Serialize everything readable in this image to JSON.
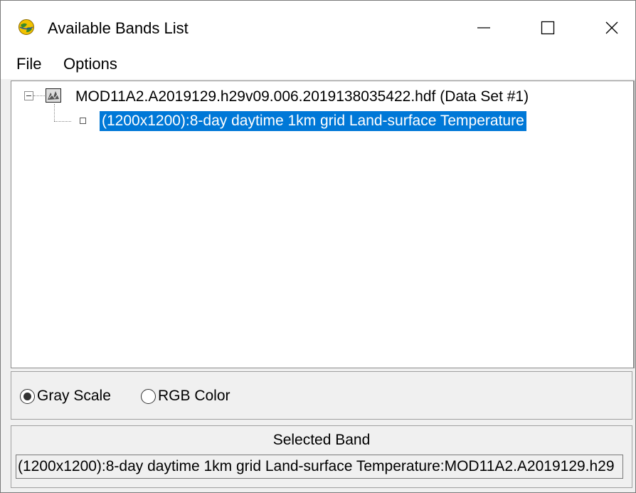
{
  "window": {
    "title": "Available Bands List",
    "icon": "globe-app-icon",
    "controls": [
      "minimize",
      "maximize",
      "close"
    ]
  },
  "menu": {
    "file": "File",
    "options": "Options"
  },
  "tree": {
    "dataset_label": "MOD11A2.A2019129.h29v09.006.2019138035422.hdf (Data Set #1)",
    "band_label": "(1200x1200):8-day daytime 1km grid Land-surface Temperature",
    "band_selected": true,
    "dataset_expanded": true
  },
  "color_mode": {
    "gray_label": "Gray Scale",
    "rgb_label": "RGB Color",
    "selected": "Gray Scale"
  },
  "selected_band": {
    "title": "Selected Band",
    "value": "(1200x1200):8-day daytime 1km grid Land-surface Temperature:MOD11A2.A2019129.h29"
  },
  "colors": {
    "selection": "#0078d7",
    "window_bg": "#f0f0f0"
  }
}
